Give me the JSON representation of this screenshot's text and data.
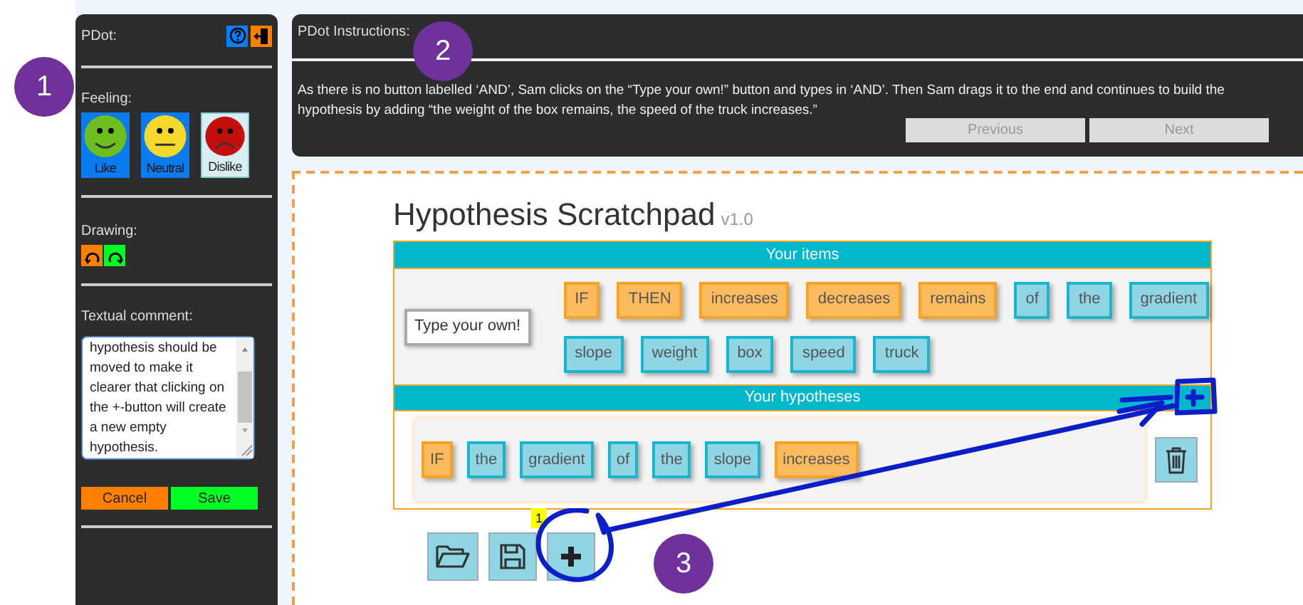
{
  "sidebar": {
    "title": "PDot:",
    "feeling": {
      "label": "Feeling:",
      "options": [
        {
          "kind": "happy",
          "label": "Like",
          "selected": true
        },
        {
          "kind": "neutral",
          "label": "Neutral",
          "selected": true
        },
        {
          "kind": "sad",
          "label": "Dislike",
          "selected": false
        }
      ]
    },
    "drawing": {
      "label": "Drawing:"
    },
    "comment": {
      "label": "Textual comment:",
      "value": "hypothesis should be moved to make it clearer that clicking on the +-button will create a new empty hypothesis."
    },
    "buttons": [
      {
        "kind": "cancel",
        "label": "Cancel"
      },
      {
        "kind": "save",
        "label": "Save"
      }
    ]
  },
  "instructions": {
    "title": "PDot Instructions:",
    "text": "As there is no button labelled ‘AND’, Sam clicks on the “Type your own!” button and types in ‘AND’. Then Sam drags it to the end and continues to build the hypothesis by adding “the weight of the box remains, the speed of the truck increases.”",
    "buttons": [
      "Previous",
      "Next"
    ]
  },
  "scratchpad": {
    "title": "Hypothesis Scratchpad",
    "version": "v1.0",
    "items_header": "Your items",
    "type_own": "Type your own!",
    "item_rows": [
      [
        {
          "kind": "keyword",
          "label": "IF"
        },
        {
          "kind": "keyword",
          "label": "THEN"
        },
        {
          "kind": "keyword",
          "label": "increases"
        },
        {
          "kind": "keyword",
          "label": "decreases"
        },
        {
          "kind": "keyword",
          "label": "remains"
        },
        {
          "kind": "noun",
          "label": "of"
        },
        {
          "kind": "noun",
          "label": "the"
        },
        {
          "kind": "noun",
          "label": "gradient"
        }
      ],
      [
        {
          "kind": "noun",
          "label": "slope"
        },
        {
          "kind": "noun",
          "label": "weight"
        },
        {
          "kind": "noun",
          "label": "box"
        },
        {
          "kind": "noun",
          "label": "speed"
        },
        {
          "kind": "noun",
          "label": "truck"
        }
      ]
    ],
    "hypotheses_header": "Your hypotheses",
    "hypothesis": [
      {
        "kind": "keyword",
        "label": "IF"
      },
      {
        "kind": "noun",
        "label": "the"
      },
      {
        "kind": "noun",
        "label": "gradient"
      },
      {
        "kind": "noun",
        "label": "of"
      },
      {
        "kind": "noun",
        "label": "the"
      },
      {
        "kind": "noun",
        "label": "slope"
      },
      {
        "kind": "keyword",
        "label": "increases"
      }
    ],
    "badge": "1"
  },
  "annotations": [
    "1",
    "2",
    "3"
  ]
}
